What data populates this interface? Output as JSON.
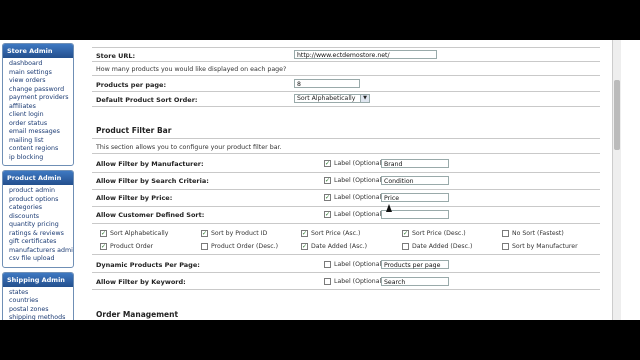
{
  "sidebar": {
    "store_admin": {
      "title": "Store Admin",
      "items": [
        "dashboard",
        "main settings",
        "view orders",
        "change password",
        "payment providers",
        "affiliates",
        "client login",
        "order status",
        "email messages",
        "mailing list",
        "content regions",
        "ip blocking"
      ]
    },
    "product_admin": {
      "title": "Product Admin",
      "items": [
        "product admin",
        "product options",
        "categories",
        "discounts",
        "quantity pricing",
        "ratings & reviews",
        "gift certificates",
        "manufacturers admin",
        "csv file upload"
      ]
    },
    "shipping_admin": {
      "title": "Shipping Admin",
      "items": [
        "states",
        "countries",
        "postal zones",
        "shipping methods"
      ]
    }
  },
  "settings": {
    "store_url_label": "Store URL:",
    "store_url_value": "http://www.ectdemostore.net/",
    "products_question": "How many products you would like displayed on each page?",
    "products_per_page_label": "Products per page:",
    "products_per_page_value": "8",
    "sort_order_label": "Default Product Sort Order:",
    "sort_order_value": "Sort Alphabetically"
  },
  "filter_bar": {
    "title": "Product Filter Bar",
    "description": "This section allows you to configure your product filter bar.",
    "label_optional": "Label (Optional)",
    "filters": [
      {
        "label": "Allow Filter by Manufacturer:",
        "checked": true,
        "value": "Brand"
      },
      {
        "label": "Allow Filter by Search Criteria:",
        "checked": true,
        "value": "Condition"
      },
      {
        "label": "Allow Filter by Price:",
        "checked": true,
        "value": "Price"
      },
      {
        "label": "Allow Customer Defined Sort:",
        "checked": true,
        "value": ""
      }
    ],
    "sort_options": [
      {
        "label": "Sort Alphabetically",
        "checked": true
      },
      {
        "label": "Sort by Product ID",
        "checked": true
      },
      {
        "label": "Sort Price (Asc.)",
        "checked": true
      },
      {
        "label": "Sort Price (Desc.)",
        "checked": true
      },
      {
        "label": "No Sort (Fastest)",
        "checked": false
      },
      {
        "label": "Product Order",
        "checked": true
      },
      {
        "label": "Product Order (Desc.)",
        "checked": false
      },
      {
        "label": "Date Added (Asc.)",
        "checked": true
      },
      {
        "label": "Date Added (Desc.)",
        "checked": false
      },
      {
        "label": "Sort by Manufacturer",
        "checked": false
      }
    ],
    "dynamic_label": "Dynamic Products Per Page:",
    "dynamic_checked": false,
    "dynamic_value": "Products per page",
    "keyword_label": "Allow Filter by Keyword:",
    "keyword_checked": false,
    "keyword_value": "Search"
  },
  "order_management": {
    "title": "Order Management"
  }
}
